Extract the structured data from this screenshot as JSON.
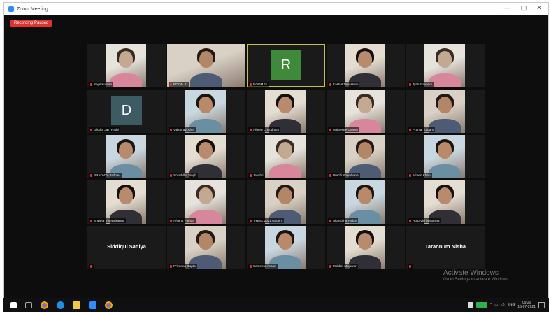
{
  "window": {
    "title": "Zoom Meeting"
  },
  "recording": {
    "label": "Recording Paused"
  },
  "colors": {
    "recording": "#e0332f",
    "active_speaker": "#c8c23a",
    "avatar_R": "#3f8a3a",
    "avatar_D": "#3d5b63"
  },
  "participants": [
    {
      "name": "Sejal Kumari",
      "type": "video"
    },
    {
      "name": "ROOM 21",
      "type": "video-wide"
    },
    {
      "name": "ROOM 11",
      "type": "avatar",
      "letter": "R",
      "active": true
    },
    {
      "name": "Kashaf Tabassum",
      "type": "video"
    },
    {
      "name": "Jyoti Gavandi",
      "type": "video"
    },
    {
      "name": "Diksha Jain Rathi",
      "type": "avatar",
      "letter": "D"
    },
    {
      "name": "Vaishnavi Aher",
      "type": "video"
    },
    {
      "name": "Afreen Choudhary",
      "type": "video"
    },
    {
      "name": "Maitreyee Umesh",
      "type": "video"
    },
    {
      "name": "Pranjal Kadam",
      "type": "video"
    },
    {
      "name": "PRADNYA Jadhav",
      "type": "video"
    },
    {
      "name": "Shraddha Singh",
      "type": "video"
    },
    {
      "name": "Jayshri",
      "type": "video"
    },
    {
      "name": "Prachi Sherkhane",
      "type": "video"
    },
    {
      "name": "Afreen Khan",
      "type": "video"
    },
    {
      "name": "Shweta Vishwakarma",
      "type": "video"
    },
    {
      "name": "Afsana Pathan",
      "type": "video"
    },
    {
      "name": "TYBSc 2021 student",
      "type": "video"
    },
    {
      "name": "Akanksha Yadav",
      "type": "video"
    },
    {
      "name": "Rutu Vishwakarma",
      "type": "video"
    },
    {
      "name": "Siddiqui Sadiya",
      "type": "name-only"
    },
    {
      "name": "Priyanka Gupta",
      "type": "video"
    },
    {
      "name": "Sameera Ansari",
      "type": "video"
    },
    {
      "name": "Mobbin Mujawar",
      "type": "video"
    },
    {
      "name": "Tarannum Nisha",
      "type": "name-only"
    }
  ],
  "watermark": {
    "title": "Activate Windows",
    "subtitle": "Go to Settings to activate Windows."
  },
  "taskbar": {
    "icons": [
      "windows-start",
      "task-view",
      "chrome",
      "edge",
      "file-explorer",
      "zoom",
      "chrome-alt"
    ],
    "tray": {
      "language": "ENG",
      "time": "09:20",
      "date": "15-07-2021"
    }
  }
}
